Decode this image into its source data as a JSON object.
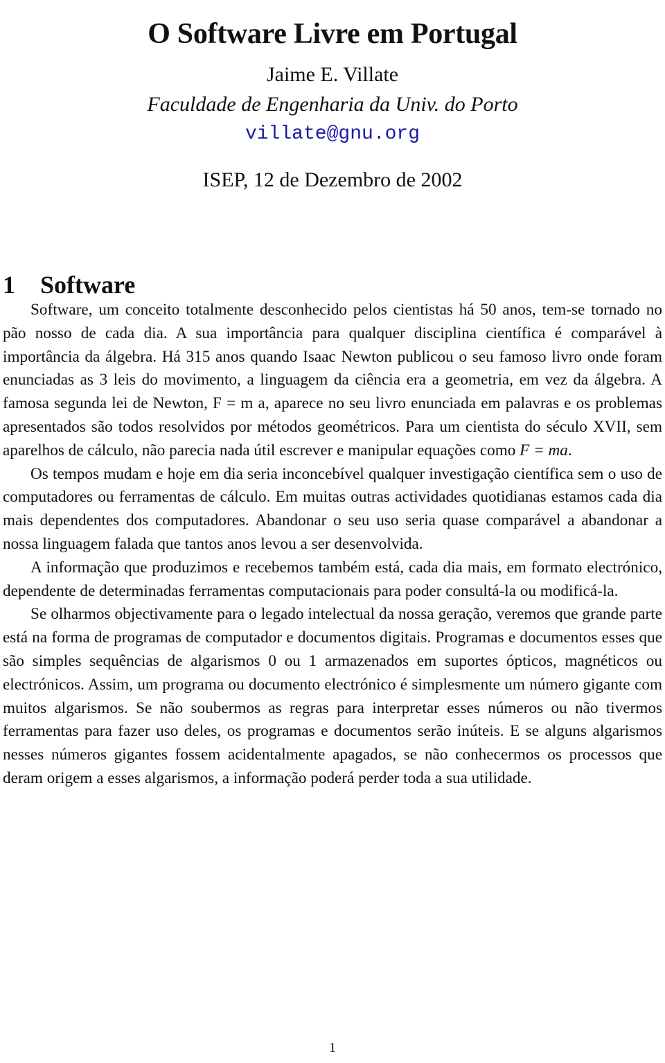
{
  "document": {
    "title": "O Software Livre em Portugal",
    "author": "Jaime E. Villate",
    "affiliation": "Faculdade de Engenharia da Univ. do Porto",
    "email": "villate@gnu.org",
    "venue_date": "ISEP, 12 de Dezembro de 2002",
    "link_color": "#1a1aa6"
  },
  "section": {
    "number": "1",
    "title": "Software"
  },
  "paragraphs": [
    {
      "before": "Software, um conceito totalmente desconhecido pelos cientistas há 50 anos, tem-se tornado no pão nosso de cada dia. A sua importância para qualquer disciplina científica é comparável à importância da álgebra. Há 315 anos quando Isaac Newton publicou o seu famoso livro onde foram enunciadas as 3 leis do movimento, a linguagem da ciência era a geometria, em vez da álgebra. A famosa segunda lei de Newton, F = m a, aparece no seu livro enunciada em palavras e os problemas apresentados são todos resolvidos por métodos geométricos. Para um cientista do século XVII, sem aparelhos de cálculo, não parecia nada útil escrever e manipular equações como ",
      "math": "F = ma",
      "after": "."
    },
    {
      "text": "Os tempos mudam e hoje em dia seria inconcebível qualquer investigação científica sem o uso de computadores ou ferramentas de cálculo. Em muitas outras actividades quotidianas estamos cada dia mais dependentes dos computadores. Abandonar o seu uso seria quase comparável a abandonar a nossa linguagem falada que tantos anos levou a ser desenvolvida."
    },
    {
      "text": "A informação que produzimos e recebemos também está, cada dia mais, em formato electrónico, dependente de determinadas ferramentas computacionais para poder consultá-la ou modificá-la."
    },
    {
      "text": "Se olharmos objectivamente para o legado intelectual da nossa geração, veremos que grande parte está na forma de programas de computador e documentos digitais. Programas e documentos esses que são simples sequências de algarismos 0 ou 1 armazenados em suportes ópticos, magnéticos ou electrónicos. Assim, um programa ou documento electrónico é simplesmente um número gigante com muitos algarismos. Se não soubermos as regras para interpretar esses números ou não tivermos ferramentas para fazer uso deles, os programas e documentos serão inúteis. E se alguns algarismos nesses números gigantes fossem acidentalmente apagados, se não conhecermos os processos que deram origem a esses algarismos, a informação poderá perder toda a sua utilidade."
    }
  ],
  "footer": {
    "page_number": "1"
  }
}
